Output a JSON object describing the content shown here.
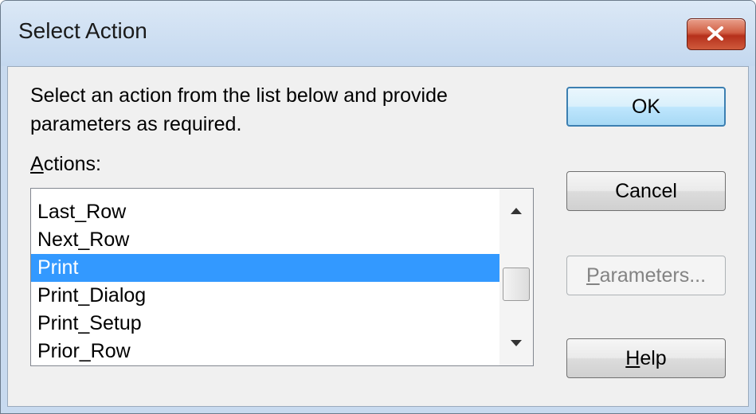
{
  "window": {
    "title": "Select Action"
  },
  "description": "Select an action from the list below and provide parameters as required.",
  "actions_label": {
    "accel": "A",
    "rest": "ctions:"
  },
  "actions": [
    "Last_Row",
    "Next_Row",
    "Print",
    "Print_Dialog",
    "Print_Setup",
    "Prior_Row"
  ],
  "selected_action": "Print",
  "buttons": {
    "ok": "OK",
    "cancel": "Cancel",
    "parameters": {
      "accel": "P",
      "rest": "arameters...",
      "enabled": false
    },
    "help": {
      "accel": "H",
      "rest": "elp"
    }
  },
  "colors": {
    "selection": "#3399ff",
    "titlebar": "#c4d8ef",
    "close": "#c8452d"
  },
  "icons": [
    "close-icon",
    "scroll-up-arrow-icon",
    "scroll-down-arrow-icon"
  ]
}
